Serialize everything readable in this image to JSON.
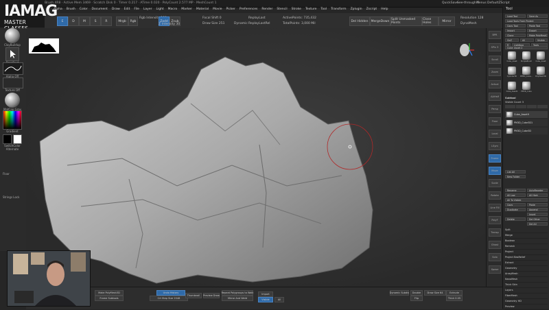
{
  "app": {
    "title_bar": "ZBrush 4R8 · Active Mem 3469 · Scratch Disk 0 · Timer 0.217 · ATime 0.020 · PolyCount 2.577 MP · MeshCount 1",
    "quicksave": "QuickSave",
    "see_through": "See-through 0",
    "menus_label": "Menus",
    "default_script": "DefaultZScript"
  },
  "logo": {
    "line1": "IAMAG",
    "line2": "MASTER CLASSES"
  },
  "menus": [
    "Alpha",
    "Brush",
    "Color",
    "Document",
    "Draw",
    "Edit",
    "File",
    "Layer",
    "Light",
    "Macro",
    "Marker",
    "Material",
    "Movie",
    "Picker",
    "Preferences",
    "Render",
    "Stencil",
    "Stroke",
    "Texture",
    "Tool",
    "Transform",
    "Zplugin",
    "Zscript",
    "Help"
  ],
  "shelf": {
    "zadd": "Zadd",
    "zsub": "Zsub",
    "zcut": "Zcut",
    "focal_shift": "Focal Shift 0",
    "draw_size": "Draw Size 251",
    "dynamic": "Dynamic",
    "z_intensity": "Z Intensity 30",
    "rgb": "Rgb",
    "rgb_intensity": "Rgb Intensity 100",
    "mrgb": "Mrgb",
    "replay_last": "ReplayLast",
    "replay_last_rel": "ReplayLastRel",
    "active_points": "ActivePoints: 735,432",
    "total_points": "TotalPoints: 3,000 Mil",
    "adjustment": "Adjustment",
    "del_hidden": "Del Hidden",
    "merge_down": "MergeDown",
    "split_unmasked": "Split Unmasked Points",
    "del_higher": "Del Higher",
    "close_holes": "Close Holes",
    "mirror": "Mirror",
    "resolution": "Resolution 128",
    "dynamesh": "DynaMesh"
  },
  "left_panel": {
    "brush": "ClayBuildup",
    "stroke": "DragRect",
    "alpha": "Alpha Off",
    "texture": "Texture Off",
    "material": "MatCap Gray",
    "gradient": "Gradient",
    "switch_color": "SwitchColor",
    "alternate": "Alternate",
    "floor": "Floor",
    "strings_lock": "Strings Lock"
  },
  "right_bar": [
    "BPR",
    "SPix 3",
    "Scroll",
    "Zoom",
    "Actual",
    "AAHalf",
    "Persp",
    "Floor",
    "Local",
    "LSym",
    "Frame",
    "Move",
    "Scale",
    "Rotate",
    "Line Fill",
    "PolyF",
    "Transp",
    "Ghost",
    "Solo",
    "Xpose"
  ],
  "tool_tray": {
    "header": "Tool",
    "buttons": [
      "Load Tool",
      "Save As",
      "Load Tools From Project",
      "Copy Tool",
      "Paste Tool",
      "Import",
      "Export",
      "Clone",
      "Make PolyMesh3D",
      "GoZ",
      "All",
      "Visible",
      "R",
      "Lightbox",
      "Tools"
    ],
    "current_tool": "Cube_Asset 2",
    "thumbs": [
      "Cube_Asset",
      "SimpleBrush",
      "Cube_Asset",
      "Cylinder3D",
      "PM3D_Cube...",
      "PolyMesh3D",
      "Cube_Asset1",
      "PM3D_Cube"
    ],
    "subtool_header": "Subtool",
    "subtool_count": "Visible Count 3",
    "subtools": [
      "Cube_Asset9",
      "PM3D_Cube3D1",
      "PM3D_Cube3D"
    ],
    "list_all": "List All",
    "new_folder": "New Folder",
    "rename": "Rename",
    "auto_reorder": "AutoReorder",
    "all_low": "All Low",
    "all_high": "All High",
    "all_to_visible": "All To Visible",
    "copy": "Copy",
    "paste": "Paste",
    "duplicate": "Duplicate",
    "append": "Append",
    "insert": "Insert",
    "delete": "Delete",
    "del_other": "Del Other",
    "del_all": "Del All",
    "sections": [
      "Split",
      "Merge",
      "Boolean",
      "Remesh",
      "Project",
      "Project BasRelief",
      "Extract",
      "Geometry",
      "ArrayMesh",
      "NanoMesh",
      "Thick Skin",
      "Layers",
      "FiberMesh",
      "Geometry HD",
      "Preview"
    ]
  },
  "bottom_bar": {
    "make_polymesh": "Make PolyMesh3D",
    "frame_subtools": "Frame Subtools",
    "undo_history": "Undo History",
    "cs_step_size": "Crt Step Size 2048",
    "thumbnail": "Thumbnail",
    "preview_draw": "Preview Draw",
    "repeat_polygroups": "Repeat Polygroups to Walk",
    "mirror_and_weld": "Mirror And Weld",
    "import": "Import",
    "visible": "Visible",
    "all": "All",
    "bpr_resolution": "BPR Resolution",
    "dynamic_subdiv": "Dynamic Subdiv",
    "double": "Double",
    "flip": "Flip",
    "smooth_subdiv": "Smooth Subdiv",
    "draw_size": "Draw Size 64",
    "extrude": "Extrude",
    "thick": "Thick 0.05"
  },
  "colors": {
    "accent_blue": "#2f6aa8",
    "brush_ring": "#b02828",
    "bg": "#262626"
  }
}
